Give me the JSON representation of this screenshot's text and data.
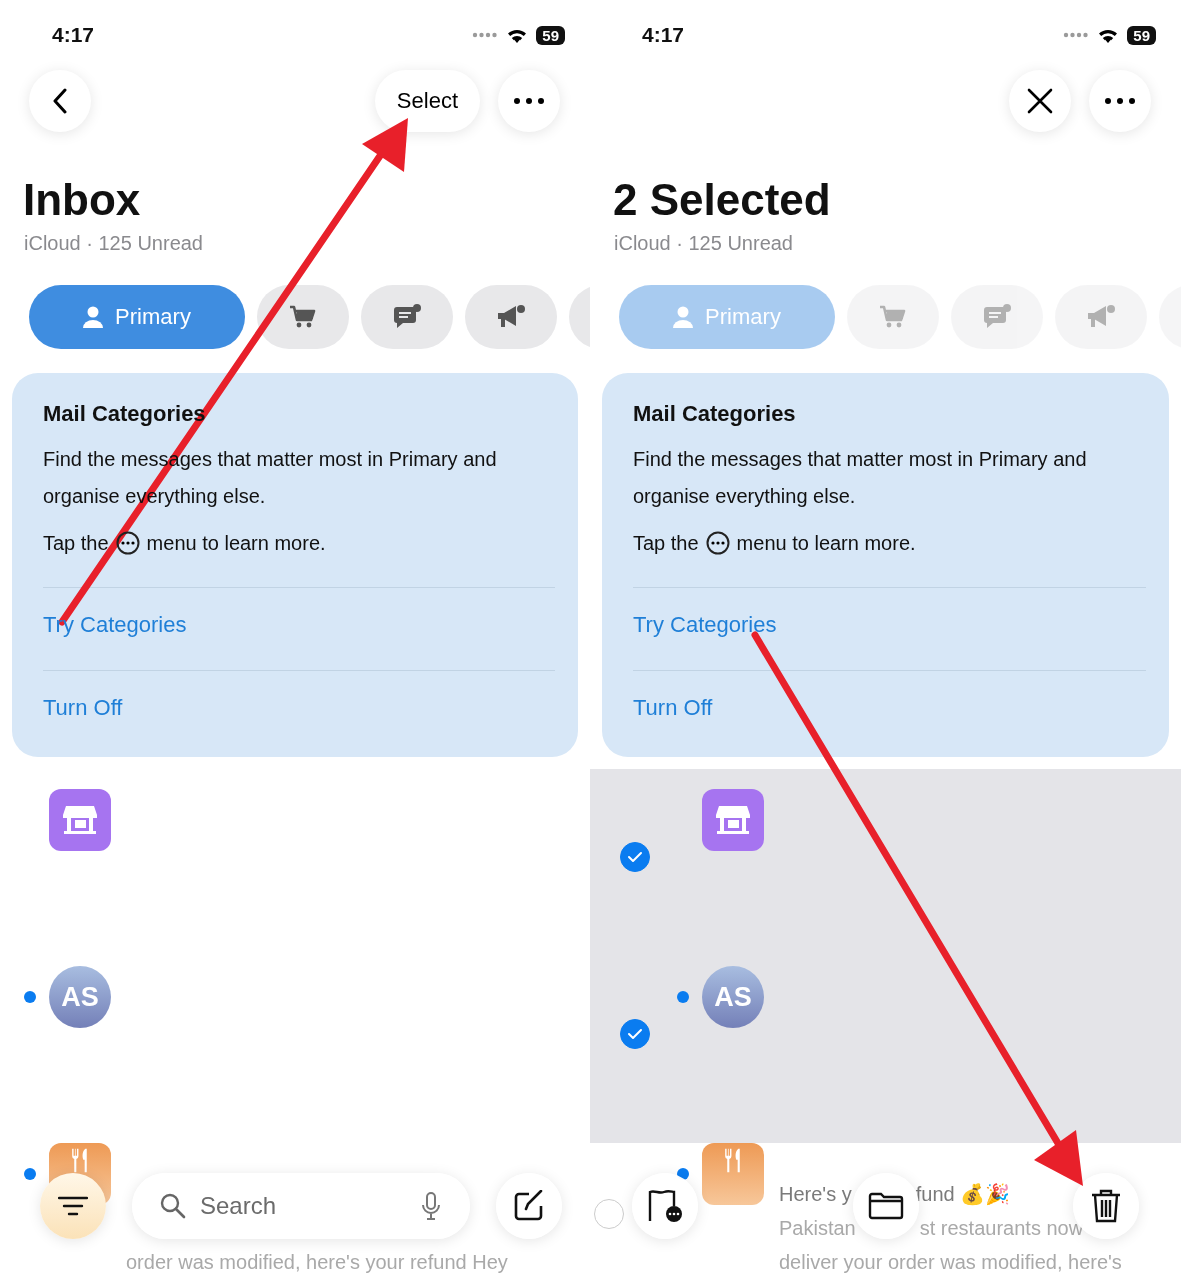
{
  "panels": [
    {
      "status": {
        "time": "4:17",
        "battery": "59"
      },
      "nav": {
        "leading": {
          "kind": "back"
        },
        "select_label": "Select"
      },
      "title": "Inbox",
      "subtitle": "iCloud · 125 Unread",
      "selecting": false,
      "tabs": [
        {
          "kind": "primary",
          "label": "Primary",
          "selected": true,
          "disabled": false
        },
        {
          "kind": "cart",
          "selected": false,
          "disabled": false
        },
        {
          "kind": "chat",
          "selected": false,
          "disabled": false
        },
        {
          "kind": "promo",
          "selected": false,
          "disabled": false
        },
        {
          "kind": "more",
          "selected": false,
          "disabled": false
        }
      ],
      "card": {
        "title": "Mail Categories",
        "body": "Find the messages that matter most in Primary and organise everything else.",
        "hint_before": "Tap the",
        "hint_after": "menu to learn more.",
        "links": [
          "Try Categories",
          "Turn Off"
        ]
      },
      "messages": [
        {
          "avatar": {
            "kind": "store"
          },
          "unread": false,
          "checked": false
        },
        {
          "avatar": {
            "kind": "initials",
            "initials": "AS"
          },
          "unread": true,
          "checked": false
        },
        {
          "avatar": {
            "kind": "food"
          },
          "unread": true,
          "checked": false,
          "lines": [
            [
              "order was modified, here's your refund Hey"
            ]
          ]
        }
      ],
      "toolbar": {
        "kind": "search",
        "placeholder": "Search"
      }
    },
    {
      "status": {
        "time": "4:17",
        "battery": "59"
      },
      "nav": {
        "leading": {
          "kind": "close"
        }
      },
      "title": "2 Selected",
      "subtitle": "iCloud · 125 Unread",
      "selecting": true,
      "tabs": [
        {
          "kind": "primary",
          "label": "Primary",
          "selected": true,
          "disabled": true
        },
        {
          "kind": "cart",
          "selected": false,
          "disabled": true
        },
        {
          "kind": "chat",
          "selected": false,
          "disabled": true
        },
        {
          "kind": "promo",
          "selected": false,
          "disabled": true
        },
        {
          "kind": "more",
          "selected": false,
          "disabled": true
        }
      ],
      "card": {
        "title": "Mail Categories",
        "body": "Find the messages that matter most in Primary and organise everything else.",
        "hint_before": "Tap the",
        "hint_after": "menu to learn more.",
        "links": [
          "Try Categories",
          "Turn Off"
        ]
      },
      "messages": [
        {
          "avatar": {
            "kind": "store"
          },
          "unread": false,
          "checked": true
        },
        {
          "avatar": {
            "kind": "initials",
            "initials": "AS"
          },
          "unread": true,
          "checked": true
        },
        {
          "avatar": {
            "kind": "food"
          },
          "unread": true,
          "checked": false,
          "lines": [
            [
              "Here's y",
              "fund 💰🎉"
            ],
            [
              "Pakistan",
              "st restaurants now"
            ],
            [
              "deliver your order was modified, here's"
            ]
          ]
        }
      ],
      "toolbar": {
        "kind": "actions"
      }
    }
  ]
}
